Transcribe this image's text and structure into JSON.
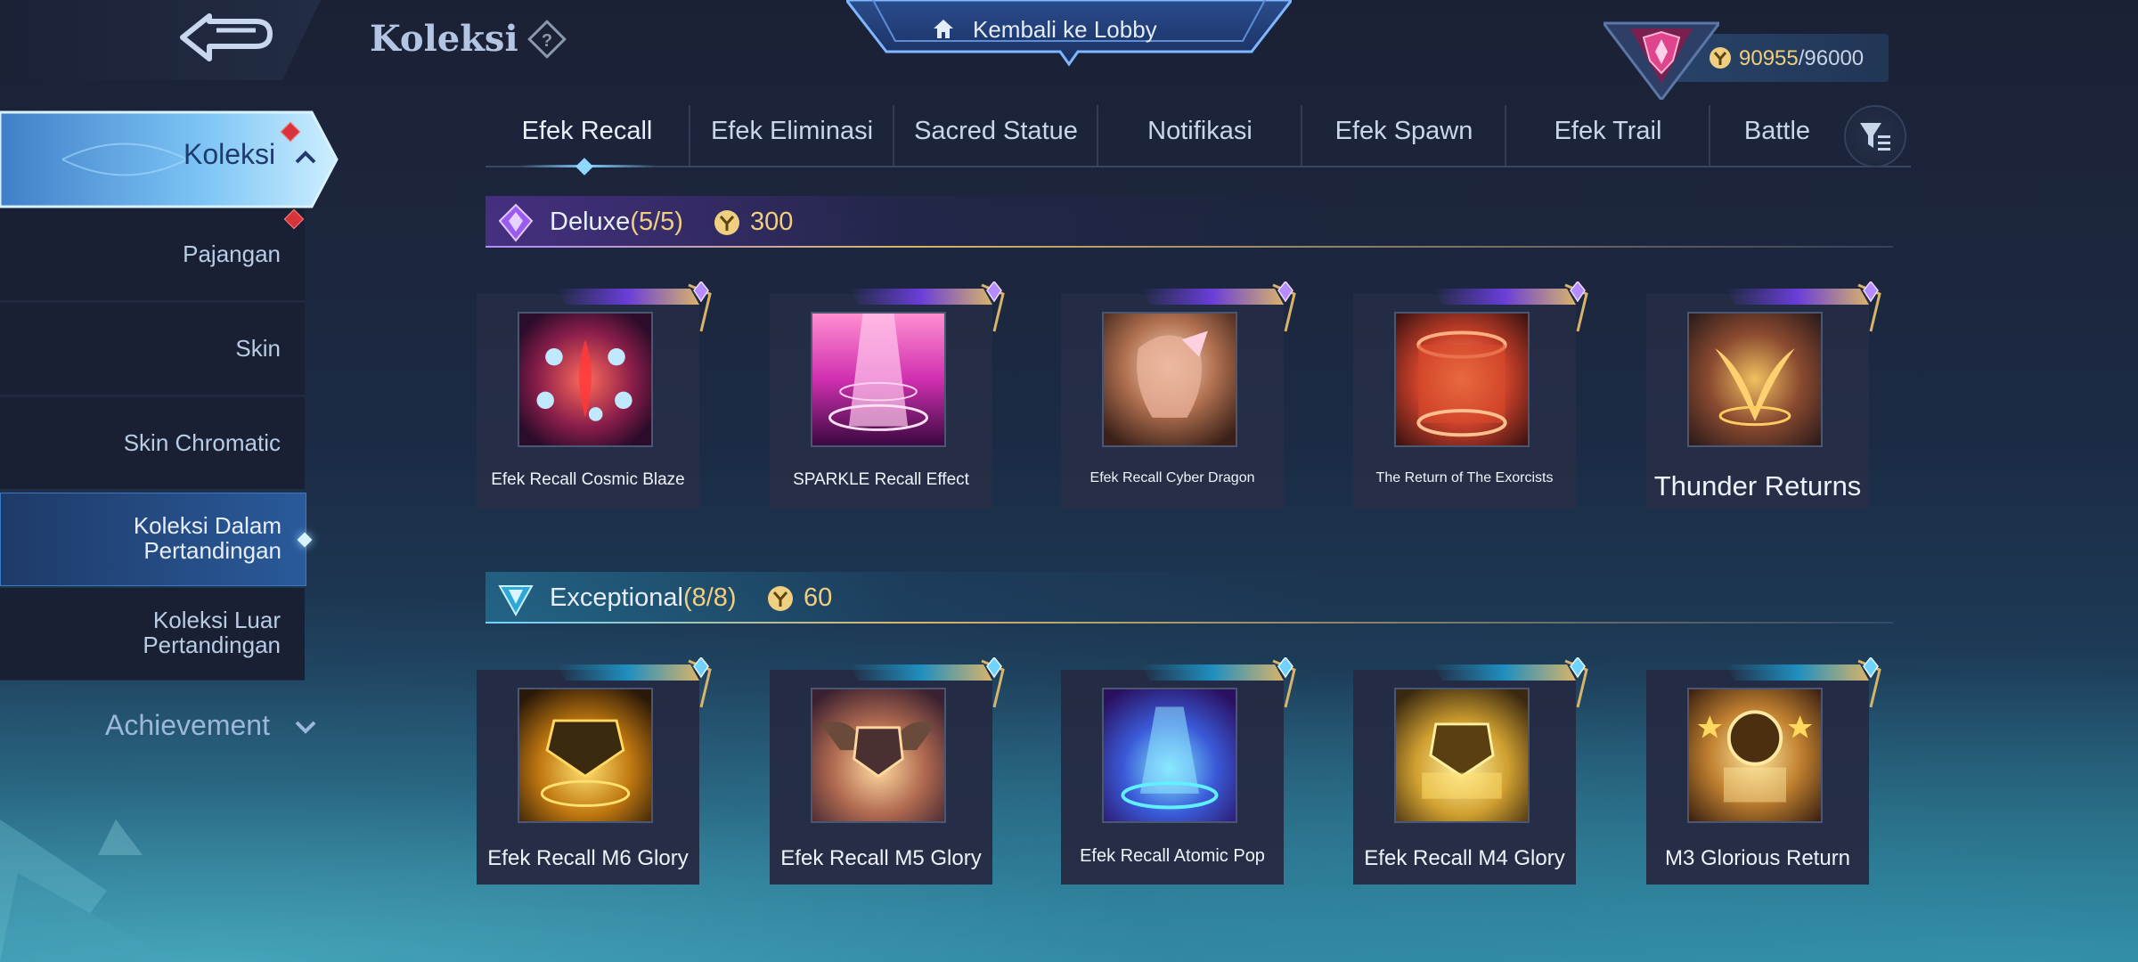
{
  "header": {
    "title": "Koleksi",
    "lobby_label": "Kembali ke Lobby",
    "currency_current": "90955",
    "currency_max": "/96000"
  },
  "sidebar": {
    "main_label": "Koleksi",
    "items": [
      {
        "label": "Pajangan",
        "active": false
      },
      {
        "label": "Skin",
        "active": false
      },
      {
        "label": "Skin Chromatic",
        "active": false
      },
      {
        "label": "Koleksi Dalam\nPertandingan",
        "active": true
      },
      {
        "label": "Koleksi Luar\nPertandingan",
        "active": false
      }
    ],
    "achievement_label": "Achievement"
  },
  "tabs": [
    "Efek Recall",
    "Efek Eliminasi",
    "Sacred Statue",
    "Notifikasi",
    "Efek Spawn",
    "Efek Trail",
    "Battle"
  ],
  "sections": {
    "deluxe": {
      "title": "Deluxe",
      "count": "(5/5)",
      "price": "300",
      "accent": "#8b5cf6",
      "items": [
        {
          "name": "Efek Recall Cosmic Blaze"
        },
        {
          "name": "SPARKLE Recall Effect"
        },
        {
          "name": "Efek Recall Cyber Dragon"
        },
        {
          "name": "The Return of The Exorcists"
        },
        {
          "name": "Thunder Returns"
        }
      ]
    },
    "exceptional": {
      "title": "Exceptional",
      "count": "(8/8)",
      "price": "60",
      "accent": "#38bdf8",
      "items": [
        {
          "name": "Efek Recall M6 Glory"
        },
        {
          "name": "Efek Recall M5 Glory"
        },
        {
          "name": "Efek Recall Atomic Pop"
        },
        {
          "name": "Efek Recall M4 Glory"
        },
        {
          "name": "M3 Glorious Return"
        }
      ]
    }
  },
  "icons": {
    "back": "back-arrow-icon",
    "help": "help-icon",
    "home": "home-icon",
    "currency": "coin-icon",
    "filter": "filter-icon",
    "rank": "rank-emblem-icon"
  },
  "colors": {
    "gold": "#f0cf80",
    "panel": "#1a2033",
    "active_tab_glow": "#7fd0ff"
  }
}
